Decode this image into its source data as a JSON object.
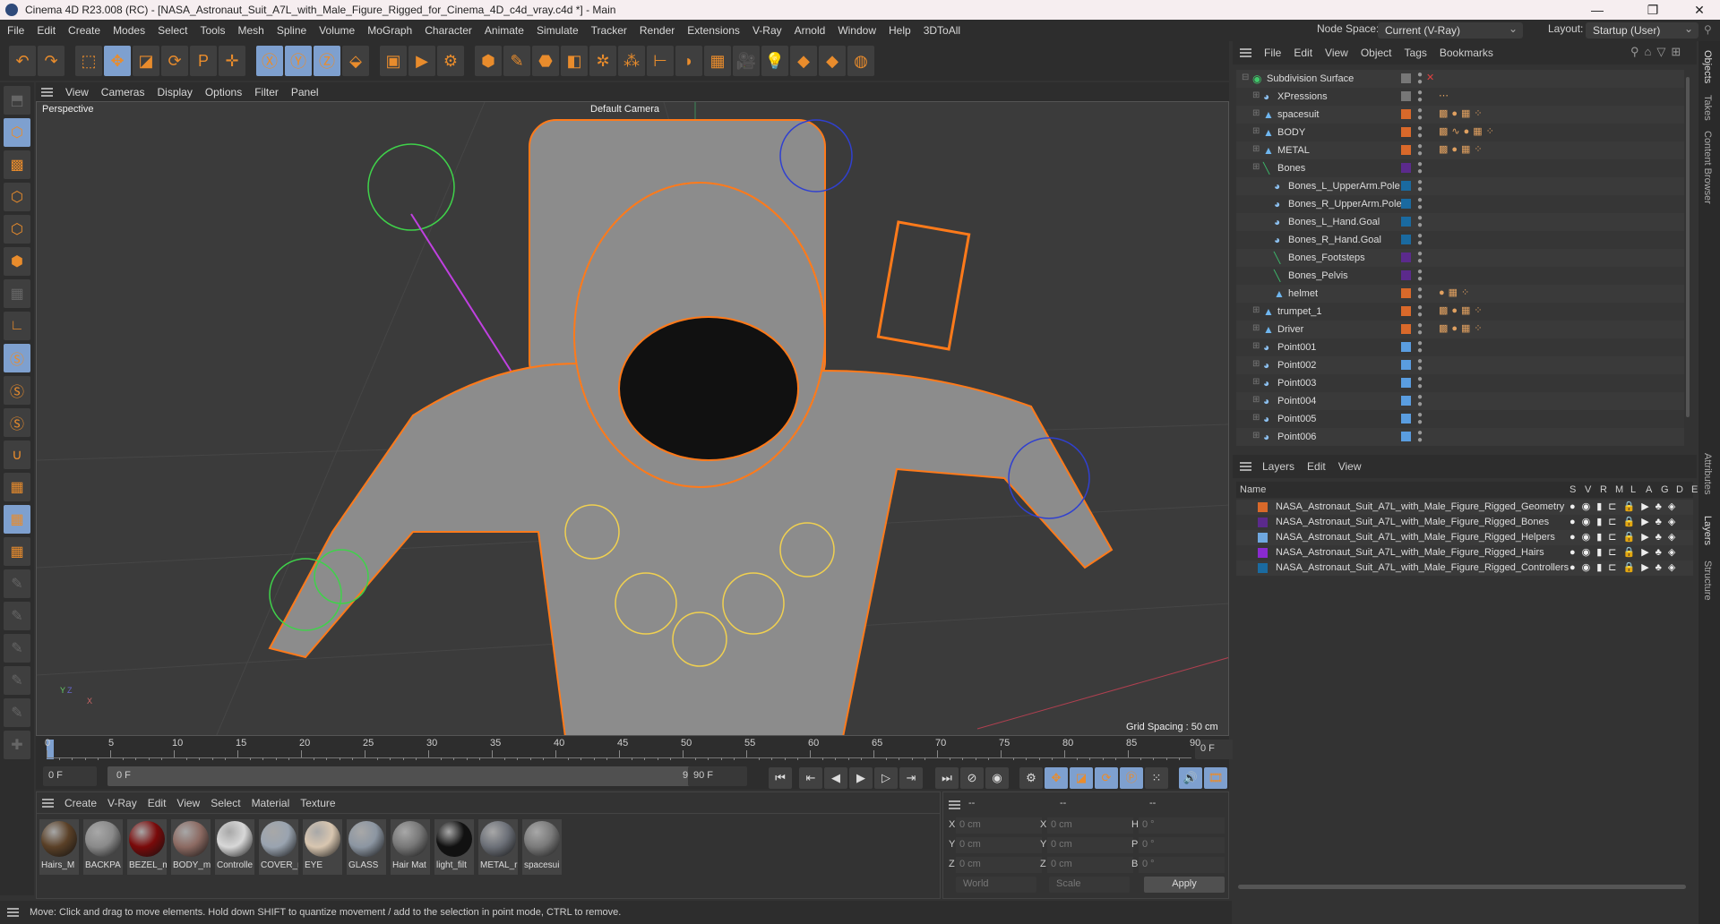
{
  "window": {
    "title": "Cinema 4D R23.008 (RC) - [NASA_Astronaut_Suit_A7L_with_Male_Figure_Rigged_for_Cinema_4D_c4d_vray.c4d *] - Main",
    "minimize": "—",
    "restore": "❐",
    "close": "✕"
  },
  "menu": [
    "File",
    "Edit",
    "Create",
    "Modes",
    "Select",
    "Tools",
    "Mesh",
    "Spline",
    "Volume",
    "MoGraph",
    "Character",
    "Animate",
    "Simulate",
    "Tracker",
    "Render",
    "Extensions",
    "V-Ray",
    "Arnold",
    "Window",
    "Help",
    "3DToAll"
  ],
  "node_space": {
    "label": "Node Space:",
    "value": "Current (V-Ray)"
  },
  "layout": {
    "label": "Layout:",
    "value": "Startup (User)"
  },
  "toolbar": [
    {
      "icon": "undo-icon",
      "g": "↶",
      "sel": false
    },
    {
      "icon": "redo-icon",
      "g": "↷",
      "sel": false
    },
    {
      "gap": true
    },
    {
      "icon": "live-selection-icon",
      "g": "⬚",
      "sel": false
    },
    {
      "icon": "move-icon",
      "g": "✥",
      "sel": true
    },
    {
      "icon": "scale-icon",
      "g": "◪",
      "sel": false
    },
    {
      "icon": "rotate-icon",
      "g": "⟳",
      "sel": false
    },
    {
      "icon": "psr-icon",
      "g": "P",
      "sel": false
    },
    {
      "icon": "transform-icon",
      "g": "✛",
      "sel": false
    },
    {
      "gap": true
    },
    {
      "icon": "x-axis-icon",
      "g": "Ⓧ",
      "sel": true
    },
    {
      "icon": "y-axis-icon",
      "g": "Ⓨ",
      "sel": true
    },
    {
      "icon": "z-axis-icon",
      "g": "Ⓩ",
      "sel": true
    },
    {
      "icon": "coordinate-system-icon",
      "g": "⬙",
      "sel": false
    },
    {
      "gap": true
    },
    {
      "icon": "render-view-icon",
      "g": "▣",
      "sel": false
    },
    {
      "icon": "render-picture-viewer-icon",
      "g": "▶",
      "sel": false
    },
    {
      "icon": "render-settings-icon",
      "g": "⚙",
      "sel": false
    },
    {
      "gap": true
    },
    {
      "icon": "cube-icon",
      "g": "⬢",
      "sel": false
    },
    {
      "icon": "pen-icon",
      "g": "✎",
      "sel": false
    },
    {
      "icon": "subdivision-icon",
      "g": "⬣",
      "sel": false
    },
    {
      "icon": "extrude-icon",
      "g": "◧",
      "sel": false
    },
    {
      "icon": "cloner-icon",
      "g": "✲",
      "sel": false
    },
    {
      "icon": "mograph-icon",
      "g": "⁂",
      "sel": false
    },
    {
      "icon": "symmetry-icon",
      "g": "⊢",
      "sel": false
    },
    {
      "icon": "deformer-icon",
      "g": "◗",
      "sel": false
    },
    {
      "icon": "floor-icon",
      "g": "▦",
      "sel": false
    },
    {
      "icon": "camera-icon",
      "g": "🎥",
      "sel": false
    },
    {
      "icon": "light-icon",
      "g": "💡",
      "sel": false
    },
    {
      "icon": "python-icon",
      "g": "◆",
      "sel": false
    },
    {
      "icon": "python-icon-2",
      "g": "◆",
      "sel": false
    },
    {
      "icon": "sphere-grid-icon",
      "g": "◍",
      "sel": false
    }
  ],
  "left_tools": [
    {
      "icon": "make-editable-icon",
      "g": "⬒",
      "s": "dim"
    },
    {
      "icon": "model-mode-icon",
      "g": "⬡",
      "s": "sel"
    },
    {
      "icon": "texture-mode-icon",
      "g": "▩",
      "s": ""
    },
    {
      "icon": "point-mode-icon",
      "g": "⬡",
      "s": ""
    },
    {
      "icon": "edge-mode-icon",
      "g": "⬡",
      "s": ""
    },
    {
      "icon": "polygon-mode-icon",
      "g": "⬢",
      "s": ""
    },
    {
      "icon": "uv-mode-icon",
      "g": "▦",
      "s": "dim"
    },
    {
      "icon": "axis-icon",
      "g": "∟",
      "s": ""
    },
    {
      "icon": "snap-icon",
      "g": "Ⓢ",
      "s": "sel"
    },
    {
      "icon": "snap-settings-icon",
      "g": "Ⓢ",
      "s": ""
    },
    {
      "icon": "snap-target-icon",
      "g": "Ⓢ",
      "s": ""
    },
    {
      "icon": "magnet-icon",
      "g": "∪",
      "s": ""
    },
    {
      "icon": "workplane-icon",
      "g": "▦",
      "s": ""
    },
    {
      "icon": "lock-workplane-icon",
      "g": "▦",
      "s": "sel"
    },
    {
      "icon": "workplane-rotate-icon",
      "g": "▦",
      "s": ""
    },
    {
      "icon": "paint-icon",
      "g": "✎",
      "s": "dim"
    },
    {
      "icon": "paint-p-icon",
      "g": "✎",
      "s": "dim"
    },
    {
      "icon": "paint-r-icon",
      "g": "✎",
      "s": "dim"
    },
    {
      "icon": "paint-target-icon",
      "g": "✎",
      "s": "dim"
    },
    {
      "icon": "paint-smooth-icon",
      "g": "✎",
      "s": "dim"
    },
    {
      "icon": "brush-add-icon",
      "g": "✚",
      "s": "dim"
    }
  ],
  "viewport": {
    "menu": [
      "View",
      "Cameras",
      "Display",
      "Options",
      "Filter",
      "Panel"
    ],
    "label": "Perspective",
    "camera": "Default Camera",
    "grid_spacing": "Grid Spacing : 50 cm",
    "axis_y": "Y",
    "axis_x": "X",
    "axis_z": "Z"
  },
  "timeline": {
    "ticks": [
      "0",
      "5",
      "10",
      "15",
      "20",
      "25",
      "30",
      "35",
      "40",
      "45",
      "50",
      "55",
      "60",
      "65",
      "70",
      "75",
      "80",
      "85",
      "90"
    ],
    "current_frame": "0 F",
    "start": "0 F",
    "range_start": "0 F",
    "range_end": "90 F",
    "end": "90 F"
  },
  "transport": [
    {
      "icon": "go-to-start-icon",
      "g": "⏮"
    },
    {
      "icon": "prev-key-icon",
      "g": "⇤"
    },
    {
      "icon": "prev-frame-icon",
      "g": "◀"
    },
    {
      "icon": "play-icon",
      "g": "▶"
    },
    {
      "icon": "next-frame-icon",
      "g": "▷"
    },
    {
      "icon": "next-key-icon",
      "g": "⇥"
    },
    {
      "icon": "go-to-end-icon",
      "g": "⏭"
    }
  ],
  "keys": [
    {
      "icon": "record-disabled-icon",
      "g": "⊘",
      "sel": false
    },
    {
      "icon": "autokey-icon",
      "g": "◉",
      "sel": false
    },
    {
      "icon": "keyframe-selection-icon",
      "g": "⚙",
      "sel": false
    },
    {
      "icon": "key-position-icon",
      "g": "✥",
      "sel": true
    },
    {
      "icon": "key-scale-icon",
      "g": "◪",
      "sel": true
    },
    {
      "icon": "key-rotation-icon",
      "g": "⟳",
      "sel": true
    },
    {
      "icon": "key-param-icon",
      "g": "Ⓟ",
      "sel": true
    },
    {
      "icon": "key-pla-icon",
      "g": "⁙",
      "sel": false
    },
    {
      "icon": "sound-icon",
      "g": "🔊",
      "sel": true
    },
    {
      "icon": "film-icon",
      "g": "🎞",
      "sel": true
    }
  ],
  "materials": {
    "menu": [
      "Create",
      "V-Ray",
      "Edit",
      "View",
      "Select",
      "Material",
      "Texture"
    ],
    "items": [
      {
        "name": "Hairs_M",
        "color": "#5a4027"
      },
      {
        "name": "BACKPA",
        "color": "#8a8a8a"
      },
      {
        "name": "BEZEL_m",
        "color": "#7a0a0a"
      },
      {
        "name": "BODY_m",
        "color": "#8c6a62"
      },
      {
        "name": "Controlle",
        "color": "#d8d8d8"
      },
      {
        "name": "COVER_r",
        "color": "#9aa4b0"
      },
      {
        "name": "EYE",
        "color": "#d8c6b0"
      },
      {
        "name": "GLASS",
        "color": "#8c96a2"
      },
      {
        "name": "Hair Mat",
        "color": "#777777"
      },
      {
        "name": "light_filt",
        "color": "#111111"
      },
      {
        "name": "METAL_r",
        "color": "#6c7078"
      },
      {
        "name": "spacesui",
        "color": "#7a7a7a"
      }
    ]
  },
  "coords": {
    "headers": [
      "--",
      "--",
      "--"
    ],
    "rows": [
      {
        "a": "X",
        "av": "0 cm",
        "b": "X",
        "bv": "0 cm",
        "c": "H",
        "cv": "0 °"
      },
      {
        "a": "Y",
        "av": "0 cm",
        "b": "Y",
        "bv": "0 cm",
        "c": "P",
        "cv": "0 °"
      },
      {
        "a": "Z",
        "av": "0 cm",
        "b": "Z",
        "bv": "0 cm",
        "c": "B",
        "cv": "0 °"
      }
    ],
    "world": "World",
    "scale": "Scale",
    "apply": "Apply"
  },
  "status": "Move: Click and drag to move elements. Hold down SHIFT to quantize movement / add to the selection in point mode, CTRL to remove.",
  "objects": {
    "menu": [
      "File",
      "Edit",
      "View",
      "Object",
      "Tags",
      "Bookmarks"
    ],
    "rows": [
      {
        "name": "Subdivision Surface",
        "indent": 0,
        "icon": "◉",
        "ic": "#3fc86a",
        "color": "#777",
        "tags": ""
      },
      {
        "name": "XPressions",
        "indent": 1,
        "icon": "◕",
        "ic": "#8cc0f0",
        "color": "#777",
        "tags": "⋯"
      },
      {
        "name": "spacesuit",
        "indent": 1,
        "icon": "▲",
        "ic": "#6fb6ef",
        "color": "#d9692a",
        "tags": "▩●▦⁘"
      },
      {
        "name": "BODY",
        "indent": 1,
        "icon": "▲",
        "ic": "#6fb6ef",
        "color": "#d9692a",
        "tags": "▩∿●▦⁘"
      },
      {
        "name": "METAL",
        "indent": 1,
        "icon": "▲",
        "ic": "#6fb6ef",
        "color": "#d9692a",
        "tags": "▩●▦⁘"
      },
      {
        "name": "Bones",
        "indent": 1,
        "icon": "╲",
        "ic": "#3cb86a",
        "color": "#5b2a8c",
        "tags": ""
      },
      {
        "name": "Bones_L_UpperArm.Pole",
        "indent": 2,
        "icon": "◕",
        "ic": "#8cc0f0",
        "color": "#1a6aa0",
        "tags": ""
      },
      {
        "name": "Bones_R_UpperArm.Pole",
        "indent": 2,
        "icon": "◕",
        "ic": "#8cc0f0",
        "color": "#1a6aa0",
        "tags": ""
      },
      {
        "name": "Bones_L_Hand.Goal",
        "indent": 2,
        "icon": "◕",
        "ic": "#8cc0f0",
        "color": "#1a6aa0",
        "tags": ""
      },
      {
        "name": "Bones_R_Hand.Goal",
        "indent": 2,
        "icon": "◕",
        "ic": "#8cc0f0",
        "color": "#1a6aa0",
        "tags": ""
      },
      {
        "name": "Bones_Footsteps",
        "indent": 2,
        "icon": "╲",
        "ic": "#3cb86a",
        "color": "#5b2a8c",
        "tags": ""
      },
      {
        "name": "Bones_Pelvis",
        "indent": 2,
        "icon": "╲",
        "ic": "#3cb86a",
        "color": "#5b2a8c",
        "tags": ""
      },
      {
        "name": "helmet",
        "indent": 2,
        "icon": "▲",
        "ic": "#6fb6ef",
        "color": "#d9692a",
        "tags": "●▦⁘"
      },
      {
        "name": "trumpet_1",
        "indent": 1,
        "icon": "▲",
        "ic": "#6fb6ef",
        "color": "#d9692a",
        "tags": "▩●▦⁘"
      },
      {
        "name": "Driver",
        "indent": 1,
        "icon": "▲",
        "ic": "#6fb6ef",
        "color": "#d9692a",
        "tags": "▩●▦⁘"
      },
      {
        "name": "Point001",
        "indent": 1,
        "icon": "◕",
        "ic": "#8cc0f0",
        "color": "#5a9de0",
        "tags": ""
      },
      {
        "name": "Point002",
        "indent": 1,
        "icon": "◕",
        "ic": "#8cc0f0",
        "color": "#5a9de0",
        "tags": ""
      },
      {
        "name": "Point003",
        "indent": 1,
        "icon": "◕",
        "ic": "#8cc0f0",
        "color": "#5a9de0",
        "tags": ""
      },
      {
        "name": "Point004",
        "indent": 1,
        "icon": "◕",
        "ic": "#8cc0f0",
        "color": "#5a9de0",
        "tags": ""
      },
      {
        "name": "Point005",
        "indent": 1,
        "icon": "◕",
        "ic": "#8cc0f0",
        "color": "#5a9de0",
        "tags": ""
      },
      {
        "name": "Point006",
        "indent": 1,
        "icon": "◕",
        "ic": "#8cc0f0",
        "color": "#5a9de0",
        "tags": ""
      }
    ]
  },
  "layers": {
    "menu": [
      "Layers",
      "Edit",
      "View"
    ],
    "name_header": "Name",
    "flag_headers": [
      "S",
      "V",
      "R",
      "M",
      "L",
      "A",
      "G",
      "D",
      "E"
    ],
    "rows": [
      {
        "name": "NASA_Astronaut_Suit_A7L_with_Male_Figure_Rigged_Geometry",
        "color": "#d9692a"
      },
      {
        "name": "NASA_Astronaut_Suit_A7L_with_Male_Figure_Rigged_Bones",
        "color": "#5b2a8c"
      },
      {
        "name": "NASA_Astronaut_Suit_A7L_with_Male_Figure_Rigged_Helpers",
        "color": "#6fa8e0"
      },
      {
        "name": "NASA_Astronaut_Suit_A7L_with_Male_Figure_Rigged_Hairs",
        "color": "#8a2ad0"
      },
      {
        "name": "NASA_Astronaut_Suit_A7L_with_Male_Figure_Rigged_Controllers",
        "color": "#1a6aa0"
      }
    ],
    "flags": "●◉▮⊏🔒▶♣◈"
  },
  "side_tabs": [
    "Objects",
    "Takes",
    "Content Browser",
    "Attributes",
    "Layers",
    "Structure"
  ]
}
